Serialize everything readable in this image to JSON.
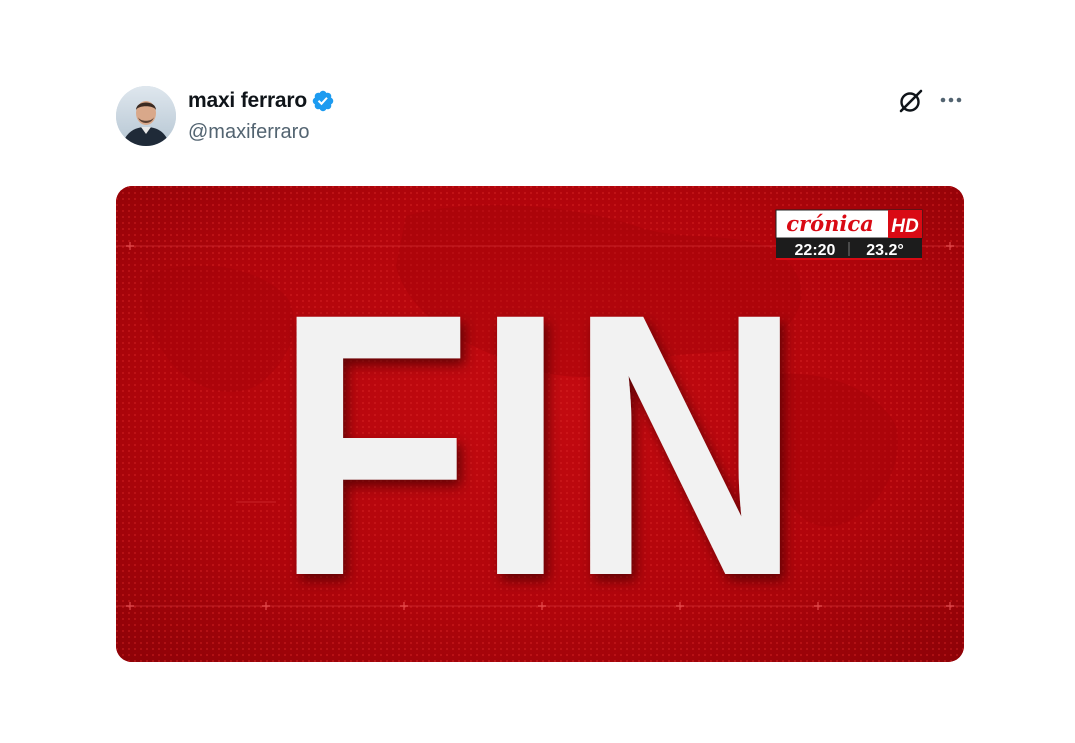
{
  "author": {
    "display_name": "maxi ferraro",
    "handle": "@maxiferraro",
    "verified": true,
    "verified_color": "#1d9bf0"
  },
  "actions": {
    "grok_icon": "grok-icon",
    "more_icon": "more-horizontal-icon"
  },
  "media": {
    "headline": "FIN",
    "channel_logo": "crónica",
    "channel_hd": "HD",
    "time": "22:20",
    "temperature": "23.2°",
    "background_color": "#b2030b",
    "headline_color": "#f2f2f2"
  }
}
